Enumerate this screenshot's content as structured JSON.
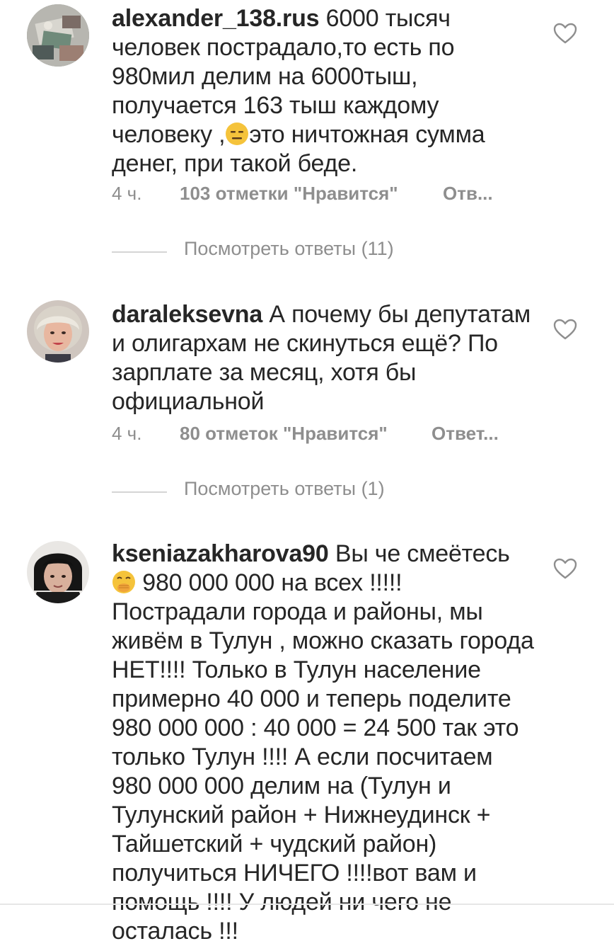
{
  "comments": [
    {
      "username": "alexander_138.rus",
      "text_before_emoji": " 6000 тысяч человек пострадало,то есть по 980мил делим на 6000тыш, получается 163 тыш  каждому человеку ,",
      "emoji": "expressionless-face",
      "text_after_emoji": "это ничтожная  сумма денег, при такой беде.",
      "time": "4 ч.",
      "likes": "103 отметки \"Нравится\"",
      "reply": "Отв...",
      "view_replies": "Посмотреть ответы (11)"
    },
    {
      "username": "daraleksevna",
      "text": " А почему бы депутатам и олигархам не скинуться ещё? По зарплате за месяц, хотя бы официальной",
      "time": "4 ч.",
      "likes": "80 отметок \"Нравится\"",
      "reply": "Ответ...",
      "view_replies": "Посмотреть ответы (1)"
    },
    {
      "username": "kseniazakharova90",
      "text_before_emoji": " Вы че смеётесь ",
      "emoji": "face-with-hand-over-mouth",
      "text_after_emoji": " 980 000 000 на всех !!!!! Пострадали города и районы, мы живём в Тулун , можно сказать города НЕТ!!!! Только в Тулун население примерно 40 000 и теперь поделите 980 000 000 : 40 000 = 24 500 так это только Тулун !!!! А если посчитаем 980 000 000 делим на (Тулун и Тулунский район + Нижнеудинск + Тайшетский + чудский район) получиться НИЧЕГО !!!!вот вам и помощь !!!! У людей ни чего не осталась !!!"
    }
  ],
  "icons": {
    "like": "heart-outline-icon"
  },
  "colors": {
    "text": "#262626",
    "secondary": "#8e8e8e",
    "divider": "#d5d5d5"
  }
}
